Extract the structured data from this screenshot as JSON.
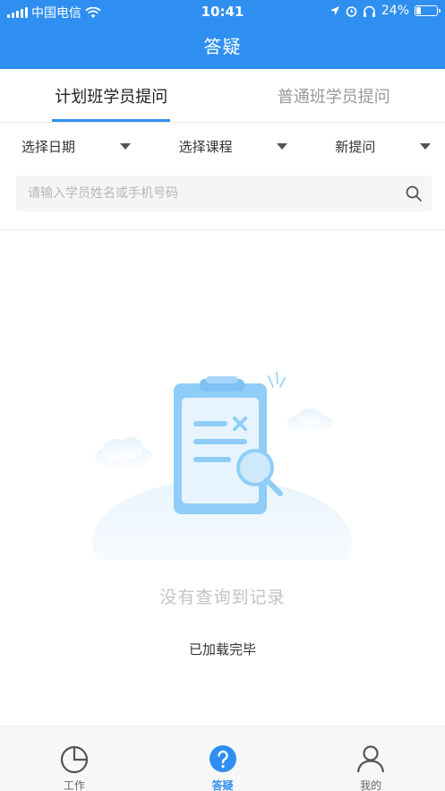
{
  "status_bar": {
    "carrier": "中国电信",
    "time": "10:41",
    "battery_percent": "24%",
    "battery_level": 0.24
  },
  "nav": {
    "title": "答疑"
  },
  "tabs": [
    {
      "label": "计划班学员提问",
      "active": true
    },
    {
      "label": "普通班学员提问",
      "active": false
    }
  ],
  "filters": {
    "date": "选择日期",
    "course": "选择课程",
    "sort": "新提问"
  },
  "search": {
    "placeholder": "请输入学员姓名或手机号码"
  },
  "empty_state": {
    "message": "没有查询到记录",
    "loaded": "已加载完毕"
  },
  "bottom_nav": [
    {
      "label": "工作",
      "icon": "pie-chart-icon",
      "active": false
    },
    {
      "label": "答疑",
      "icon": "question-icon",
      "active": true
    },
    {
      "label": "我的",
      "icon": "person-icon",
      "active": false
    }
  ],
  "colors": {
    "primary": "#2f8ff0",
    "empty_text": "#c3c3c3"
  }
}
